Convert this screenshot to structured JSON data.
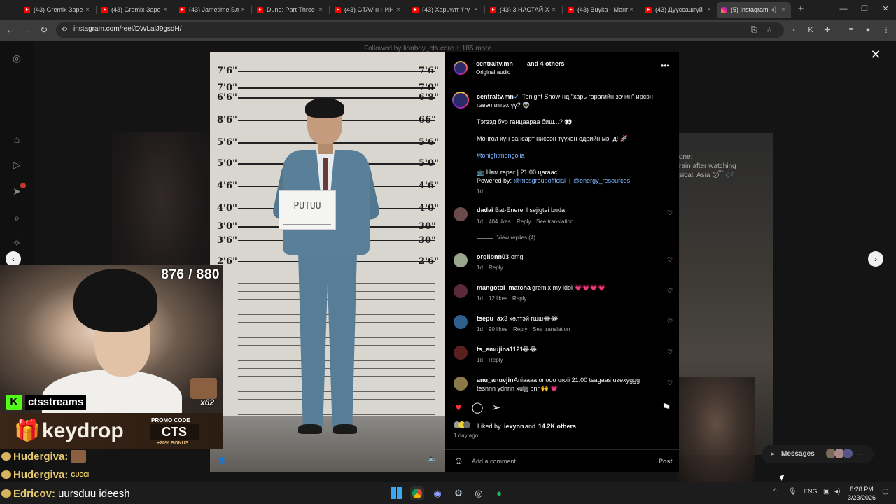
{
  "browser": {
    "tabs": [
      {
        "title": "(43) Gremix Заре"
      },
      {
        "title": "(43) Gremix Заре"
      },
      {
        "title": "(43) Jametime Бл"
      },
      {
        "title": "Dune: Part Three"
      },
      {
        "title": "(43) GTAV-н ЧИН"
      },
      {
        "title": "(43) Харьулт Үгү"
      },
      {
        "title": "(43) 3 НАСТАЙ Х"
      },
      {
        "title": "(43) Buyka - Монг"
      },
      {
        "title": "(43) Дууссашгүй"
      },
      {
        "title": "(5) Instagram",
        "active": true
      }
    ],
    "url": "instagram.com/reel/DWLalJ9gsdH/"
  },
  "page": {
    "faded_top": "Followed by lionboy_cts.core + 185 more"
  },
  "reel": {
    "left_heights": [
      "7'6\"",
      "7'0\"",
      "6'6\"",
      "8'6\"",
      "5'6\"",
      "5'0\"",
      "4'6\"",
      "4'0\"",
      "3'0\"",
      "3'6\"",
      "2'6\""
    ],
    "right_heights": [
      "7'6\"",
      "7'0\"",
      "6'8\"",
      "66\"",
      "5'6\"",
      "5'0\"",
      "4'6\"",
      "4'0\"",
      "30\"",
      "30\"",
      "2'6\""
    ],
    "placard_name": "PUTUU"
  },
  "post": {
    "author": "centraltv.mn",
    "and_others": "and 4 others",
    "audio": "Original audio",
    "caption_author": "centraltv.mn",
    "caption_line1": "Tonight Show-нд \"харь гарагийн зочин\" ирсэн",
    "caption_line2": "гэвэл итгэх үү? 👽",
    "caption_line3": "Тэгээд бүр ганцаараа биш...? 👀",
    "caption_line4": "Монгол хүн сансарт ниссэн түүхэн өдрийн мэнд! 🚀",
    "hashtag": "#tonightmongolia",
    "schedule": "📺 Ням гараг | 21:00 цагаас",
    "powered_label": "Powered by:",
    "sponsor1": "@mcsgroupofficial",
    "sep": "|",
    "sponsor2": "@energy_resources",
    "age": "1d",
    "liked_prefix": "Liked by",
    "liked_user": "iexynn",
    "liked_and": "and",
    "liked_count": "14.2K others",
    "posted": "1 day ago",
    "add_comment_placeholder": "Add a comment...",
    "post_label": "Post"
  },
  "comments": [
    {
      "user": "dadai",
      "text": "Bat-Enerel l sejigtei bnda",
      "age": "1d",
      "likes": "404 likes",
      "reply": "Reply",
      "translate": "See translation",
      "view_replies": "View replies (4)"
    },
    {
      "user": "orgilbnn03",
      "text": "omg",
      "age": "1d",
      "reply": "Reply"
    },
    {
      "user": "mangotoi_matcha",
      "text": "gremix my idol 💗💗💗💗",
      "age": "1d",
      "likes": "12 likes",
      "reply": "Reply"
    },
    {
      "user": "tsepu_ax",
      "text": "3 хөлтэй гшш😂😂",
      "age": "1d",
      "likes": "90 likes",
      "reply": "Reply",
      "translate": "See translation"
    },
    {
      "user": "ts_emujina1121",
      "text": "😂😂",
      "age": "1d",
      "reply": "Reply"
    },
    {
      "user": "anu_anuvjin",
      "text": "Aniaaaa onooo oroii 21:00 tsagaas uzexyggg",
      "text2": "tesnnn ydnnn xuljjj bnn🙌 💗"
    }
  ],
  "overlay": {
    "counter": "876 / 880",
    "kick_handle": "ctsstreams",
    "emote_count": "x62",
    "brand": "keydrop",
    "promo_label": "PROMO CODE",
    "promo_code": "CTS",
    "promo_bonus": "+20% BONUS",
    "chat": [
      {
        "user": "Hudergiva:",
        "text": ""
      },
      {
        "user": "Hudergiva:",
        "text": "GUCCI"
      }
    ],
    "ticker_user": "Edricov:",
    "ticker_text": "uursduu ideesh"
  },
  "messages_pill": {
    "label": "Messages"
  },
  "bg_right_caption": "one:\nrain after watching\nsical: Asia 😴 🎶",
  "taskbar": {
    "lang": "ENG",
    "time": "8:28 PM",
    "date": "3/23/2026"
  },
  "colors": {
    "ig_gradient": [
      "#f9ce34",
      "#ee2a7b",
      "#6228d7"
    ],
    "kick_green": "#53fc18",
    "heart_red": "#ff3040",
    "link_blue": "#7db7ff"
  }
}
